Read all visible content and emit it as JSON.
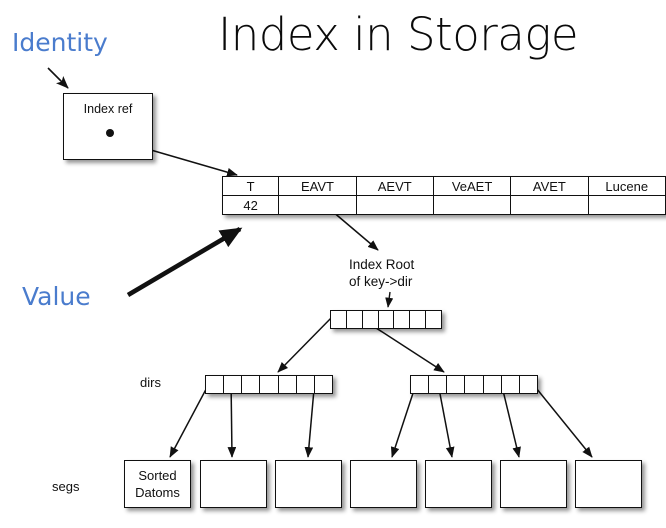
{
  "slide": {
    "title": "Index in Storage",
    "accent_color": "#4a7ccd",
    "ink_color": "#111111",
    "background_color": "#ffffff"
  },
  "annotations": {
    "identity": "Identity",
    "value": "Value",
    "index_root_line1": "Index Root",
    "index_root_line2": "of key->dir"
  },
  "index_ref": {
    "label": "Index ref"
  },
  "index_table": {
    "headers": [
      "T",
      "EAVT",
      "AEVT",
      "VeAET",
      "AVET",
      "Lucene"
    ],
    "rows": [
      [
        "42",
        "",
        "",
        "",
        "",
        ""
      ]
    ]
  },
  "tree": {
    "root": {
      "cell_count": 7
    },
    "dirs": {
      "row_label": "dirs",
      "left": {
        "cell_count": 7
      },
      "right": {
        "cell_count": 7
      }
    },
    "segs": {
      "row_label": "segs",
      "boxes": [
        {
          "line1": "Sorted",
          "line2": "Datoms"
        },
        {
          "line1": "",
          "line2": ""
        },
        {
          "line1": "",
          "line2": ""
        },
        {
          "line1": "",
          "line2": ""
        },
        {
          "line1": "",
          "line2": ""
        },
        {
          "line1": "",
          "line2": ""
        },
        {
          "line1": "",
          "line2": ""
        }
      ]
    }
  }
}
